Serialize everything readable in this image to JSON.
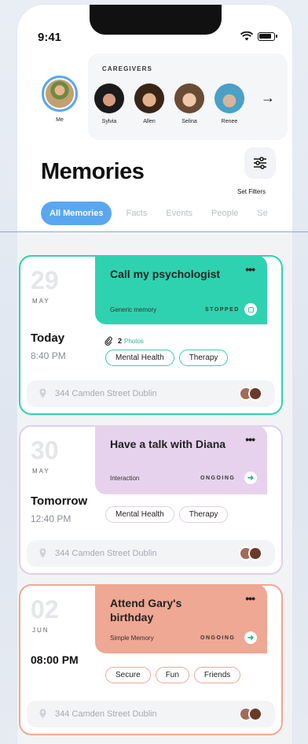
{
  "status": {
    "time": "9:41"
  },
  "me": {
    "label": "Me"
  },
  "caregivers": {
    "title": "CAREGIVERS",
    "people": [
      {
        "name": "Sylvia",
        "color_a": "#1b1b1b",
        "color_b": "#d89a7e"
      },
      {
        "name": "Allen",
        "color_a": "#3a2418",
        "color_b": "#e0b08a"
      },
      {
        "name": "Selina",
        "color_a": "#6a4b34",
        "color_b": "#f0c7a8"
      },
      {
        "name": "Renee",
        "color_a": "#4aa0c7",
        "color_b": "#d7b49a"
      }
    ]
  },
  "page": {
    "title": "Memories"
  },
  "filters": {
    "label": "Set Filters"
  },
  "tabs": [
    "All Memories",
    "Facts",
    "Events",
    "People",
    "Se"
  ],
  "accent_colors": {
    "blue": "#5aa7f0",
    "teal": "#2fd2b0",
    "lilac": "#e6d2ec",
    "salmon": "#eea894"
  },
  "memories": [
    {
      "day_num": "29",
      "month": "MAY",
      "day": "Today",
      "time": "8:40 PM",
      "title": "Call my psychologist",
      "type": "Generic memory",
      "status": "STOPPED",
      "status_icon": "stop-icon",
      "photos_count": "2",
      "photos_label": "Photos",
      "tags": [
        "Mental Health",
        "Therapy"
      ],
      "location": "344  Camden Street Dublin",
      "border": "#2fd2b0",
      "head_bg": "#2fd2b0",
      "tag_border": "#2fd2b0"
    },
    {
      "day_num": "30",
      "month": "MAY",
      "day": "Tomorrow",
      "time": "12:40 PM",
      "title": "Have a talk with Diana",
      "type": "Interaction",
      "status": "ONGOING",
      "status_icon": "arrow-right-icon",
      "tags": [
        "Mental Health",
        "Therapy"
      ],
      "location": "344  Camden Street Dublin",
      "border": "#e0cfe9",
      "head_bg": "#e6d2ec",
      "tag_border": "#e0cfe9"
    },
    {
      "day_num": "02",
      "month": "JUN",
      "day": "08:00 PM",
      "time": "",
      "title": "Attend Gary's birthday",
      "type": "Simple Memory",
      "status": "ONGOING",
      "status_icon": "arrow-right-icon",
      "tags": [
        "Secure",
        "Fun",
        "Friends"
      ],
      "location": "344  Camden Street Dublin",
      "border": "#eea894",
      "head_bg": "#eea894",
      "tag_border": "#eea894"
    }
  ]
}
